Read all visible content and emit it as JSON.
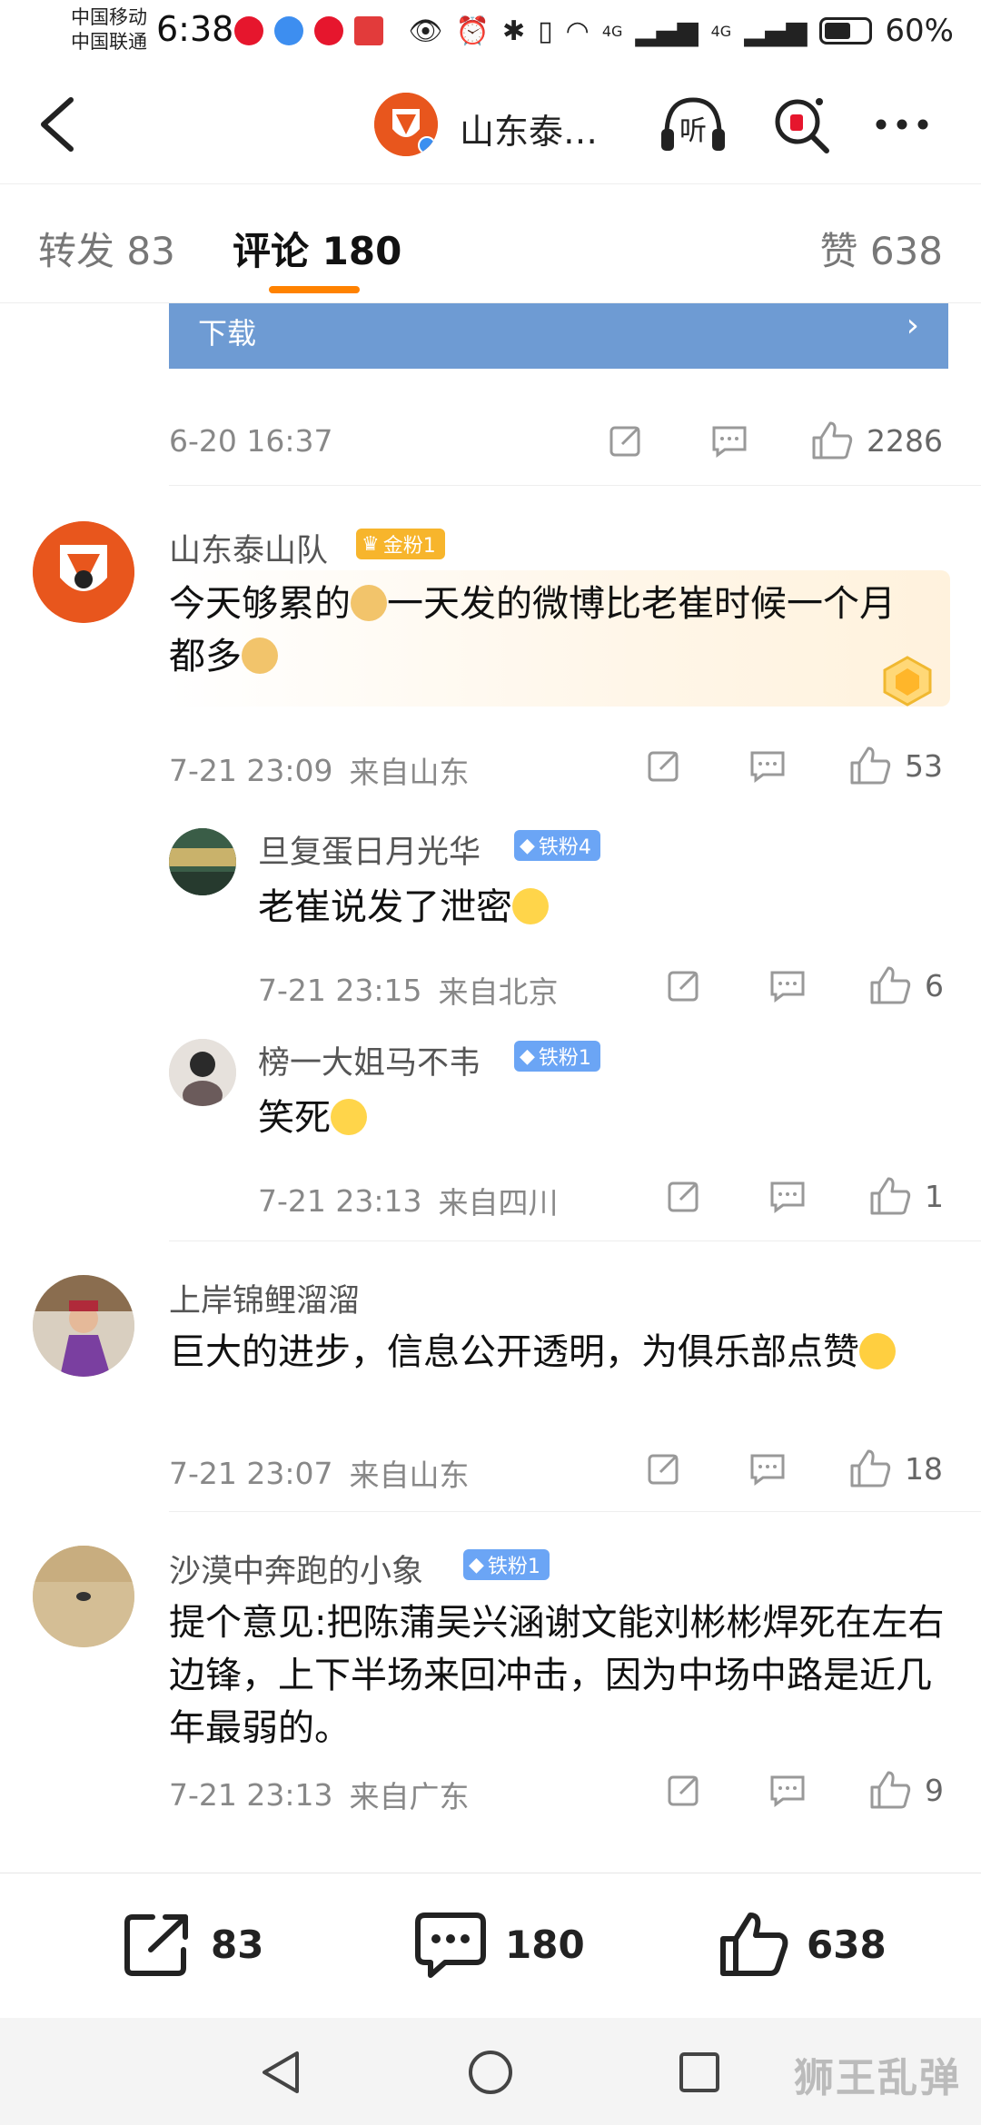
{
  "status_bar": {
    "carrier1": "中国移动",
    "carrier2": "中国联通",
    "time": "6:38",
    "signal1": "4G",
    "signal2": "4G",
    "battery": "60%",
    "battery_level": 0.6
  },
  "nav": {
    "title": "山东泰…",
    "listen_label": "听"
  },
  "tabs": {
    "repost": "转发 83",
    "comments": "评论 180",
    "likes": "赞 638"
  },
  "prev_item": {
    "banner_label": "下载",
    "time": "6-20 16:37",
    "likes": "2286"
  },
  "comments": [
    {
      "user": "山东泰山队",
      "badge": "金粉1",
      "text_a": "今天够累的",
      "text_b": "一天发的微博比老崔时候一个月都多",
      "time": "7-21 23:09",
      "location": "来自山东",
      "likes": "53"
    },
    {
      "user": "上岸锦鲤溜溜",
      "text": "巨大的进步，信息公开透明，为俱乐部点赞",
      "time": "7-21 23:07",
      "location": "来自山东",
      "likes": "18"
    },
    {
      "user": "沙漠中奔跑的小象",
      "badge": "铁粉1",
      "text": "提个意见:把陈蒲吴兴涵谢文能刘彬彬焊死在左右边锋，上下半场来回冲击，因为中场中路是近几年最弱的。",
      "time": "7-21 23:13",
      "location": "来自广东",
      "likes": "9"
    }
  ],
  "replies": [
    {
      "user": "旦复蛋日月光华",
      "badge": "铁粉4",
      "text": "老崔说发了泄密",
      "time": "7-21 23:15",
      "location": "来自北京",
      "likes": "6"
    },
    {
      "user": "榜一大姐马不韦",
      "badge": "铁粉1",
      "text": "笑死",
      "time": "7-21 23:13",
      "location": "来自四川",
      "likes": "1"
    }
  ],
  "bottom_bar": {
    "reposts": "83",
    "comments": "180",
    "likes": "638"
  },
  "watermark": "狮王乱弹",
  "colors": {
    "accent": "#ff8200",
    "banner": "#6e9bd3",
    "gold_badge": "#f7b52c",
    "iron_badge": "#6ba5f5"
  }
}
